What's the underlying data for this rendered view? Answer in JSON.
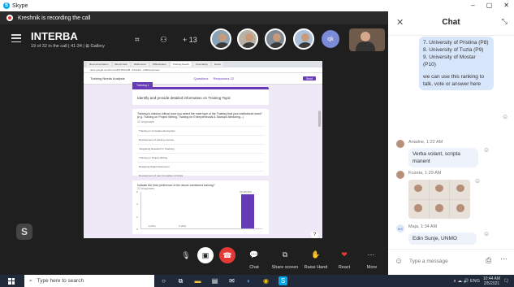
{
  "window": {
    "app_name": "Skype",
    "minimize": "–",
    "maximize": "▢",
    "close": "✕"
  },
  "recording": {
    "text": "Kreshnik is recording the call"
  },
  "call": {
    "title": "INTERBA",
    "subtitle": "19 of 32 in the call | 41:34 | ⊞ Gallery",
    "more_count": "+ 13",
    "qk_initials": "qk"
  },
  "shared_screen": {
    "tabs": [
      "Recommendation",
      "Benchmark",
      "WeReceive",
      "MSFaculties",
      "Training Needs",
      "Uncertainty",
      "Home"
    ],
    "url": "docs.google.com/forms/d/1TWHmcl8...ZJxtHKv...edit#responses",
    "form_name": "Training Needs Analysis",
    "subtabs": [
      "Questions",
      "Responses 22"
    ],
    "send": "Send",
    "section_tag": "Training 1",
    "section_title": "Identify and provide detailed information on Training Topic",
    "q1_text": "Training is mission critical once you select the main type of the Training that your institution/s need? (e.g. Training on Project Writing, Training for Entrepreneurial & Startups Mentoring...)",
    "q1_sub": "22 responses",
    "q1_options": [
      "Training on innovation Ecosystem",
      "Development of training courses",
      "Integrating Research in Teaching",
      "Training on Project Writing",
      "Designing Digital Classroom",
      "Development of new innovative curricula"
    ],
    "q2_text": "Indicate the time preference of the above-mentioned training?",
    "q2_sub": "22 responses"
  },
  "chart_data": {
    "type": "bar",
    "categories": [
      "",
      "",
      "",
      ""
    ],
    "values": [
      0,
      0,
      0,
      20
    ],
    "data_labels": [
      "0 (0%)",
      "0 (0%)",
      "",
      "20 (90.9%)"
    ],
    "yticks": [
      "6",
      "4",
      "2",
      "0"
    ],
    "ylim": [
      0,
      22
    ]
  },
  "controls": {
    "chat": "Chat",
    "share": "Share screen",
    "raise": "Raise Hand",
    "react": "React",
    "more": "More"
  },
  "chat_panel": {
    "title": "Chat",
    "list_items": [
      "7. University of Pristina (P8)",
      "8. University of Tuzla (P9)",
      "9. University of Mostar (P10)"
    ],
    "ranking_msg": "we can use this ranking to talk, vote or answer here",
    "ariadne_meta": "Ariadne, 1:22 AM",
    "ariadne_msg": "Verba volant, scripta manent",
    "kozeta_meta": "Kozeta, 1:29 AM",
    "maja_initials": "MS",
    "maja_meta": "Maja, 1:34 AM",
    "maja_msg": "Edin Sunje, UNMO",
    "compose_placeholder": "Type a message"
  },
  "taskbar": {
    "search_placeholder": "Type here to search",
    "time": "10:44 AM",
    "date": "2/5/2021",
    "tray_text": "∧ ☁ 🔊 ENG"
  }
}
